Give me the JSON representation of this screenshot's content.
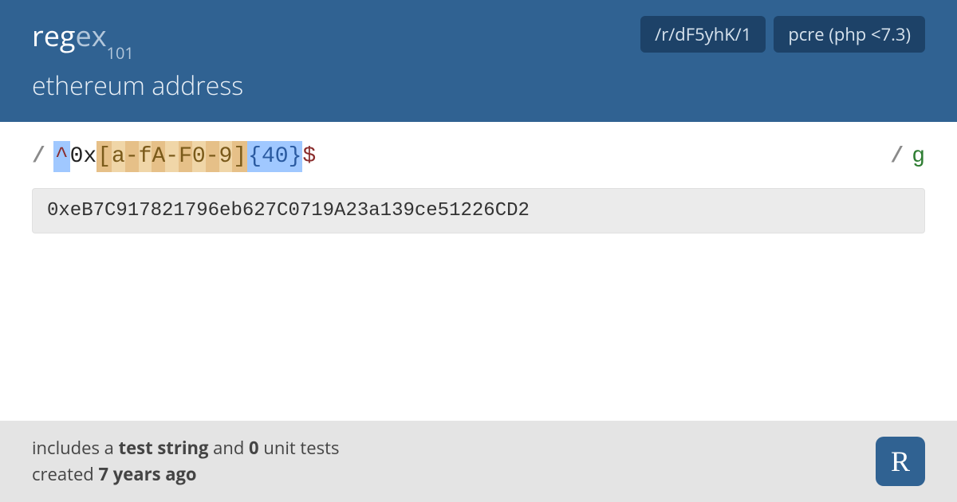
{
  "header": {
    "logo_reg": "reg",
    "logo_ex": "ex",
    "logo_sub": "101",
    "title": "ethereum address",
    "badge_path": "/r/dF5yhK/1",
    "badge_flavor": "pcre (php <7.3)"
  },
  "regex": {
    "open_slash": "/",
    "close_slash": "/",
    "flags": "g",
    "caret": "^",
    "literal_0x": "0x",
    "cc_open": "[",
    "cc_a": "a",
    "cc_dash1": "-",
    "cc_f": "f",
    "cc_A": "A",
    "cc_dash2": "-",
    "cc_F": "F",
    "cc_0": "0",
    "cc_dash3": "-",
    "cc_9": "9",
    "cc_close": "]",
    "quant": "{40}",
    "dollar": "$"
  },
  "test_string": "0xeB7C917821796eb627C0719A23a139ce51226CD2",
  "footer": {
    "line1_a": "includes a ",
    "line1_b": "test string",
    "line1_c": " and ",
    "line1_d": "0",
    "line1_e": " unit tests",
    "line2_a": "created ",
    "line2_b": "7 years ago",
    "icon_letter": "R"
  }
}
